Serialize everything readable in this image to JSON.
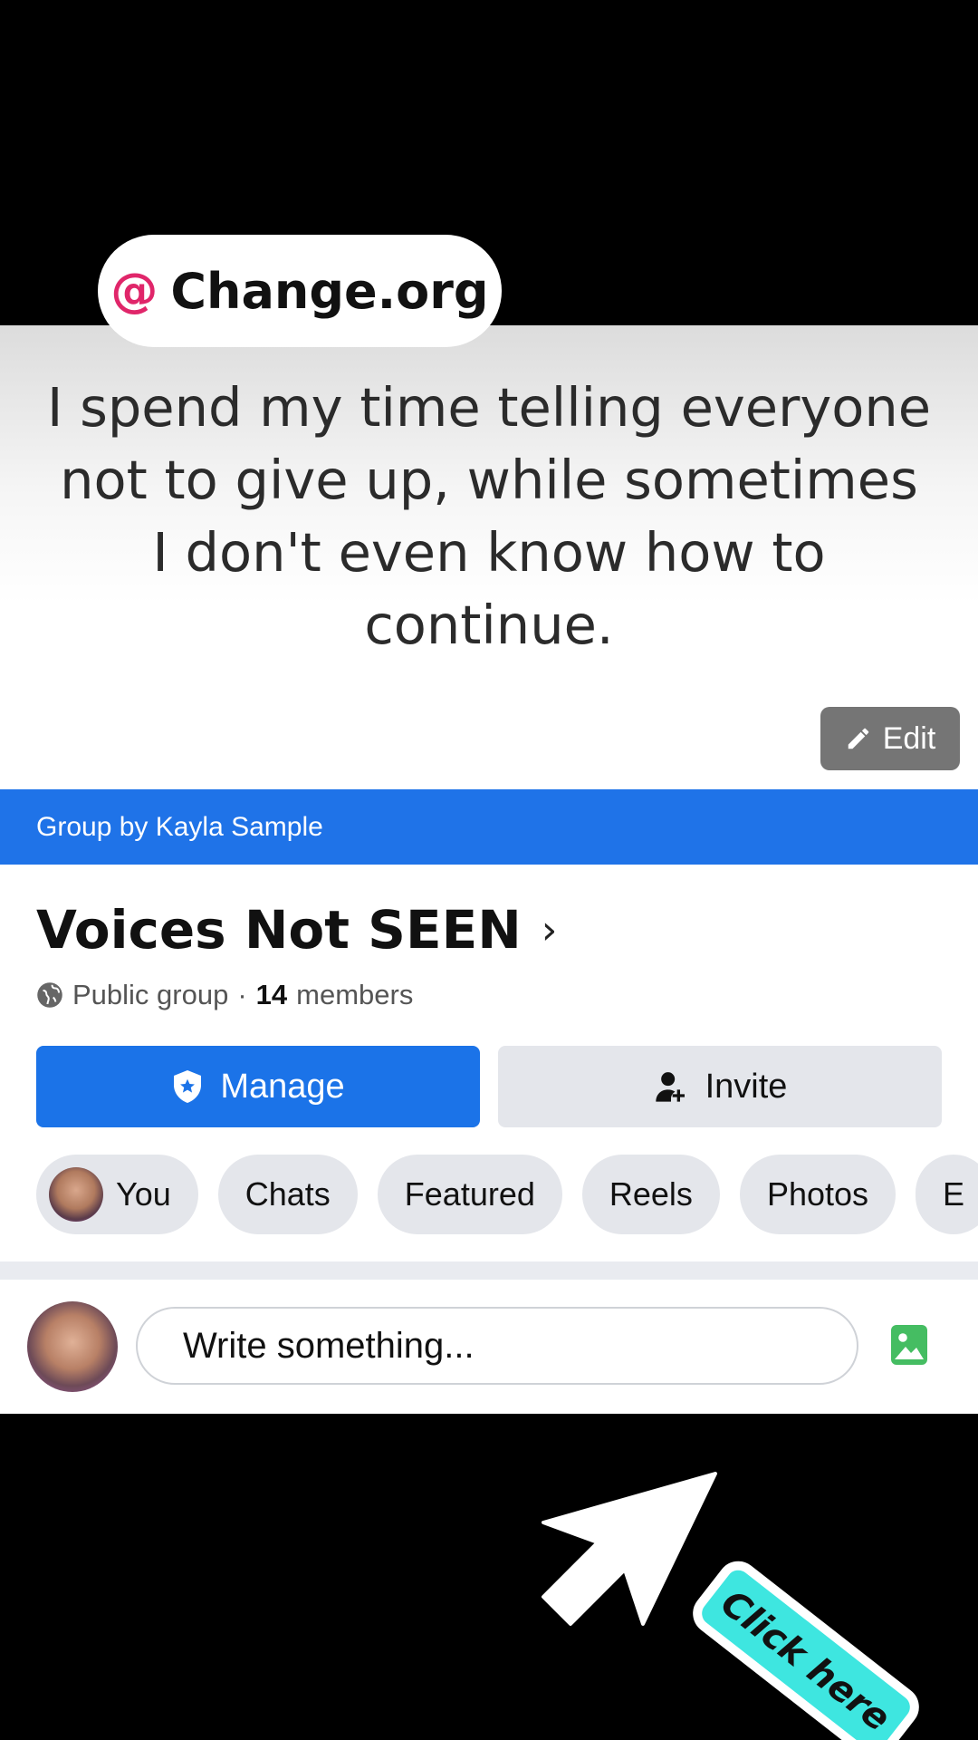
{
  "watermark": {
    "at_symbol": "@",
    "name": "Change.org"
  },
  "cover": {
    "quote_lines": [
      "I spend my time telling everyone",
      "not to give up, while sometimes",
      "I don't even know how to",
      "continue."
    ],
    "edit_label": "Edit"
  },
  "group_by": "Group by Kayla Sample",
  "group": {
    "name": "Voices Not SEEN",
    "chevron": "›",
    "privacy": "Public group",
    "separator": "·",
    "member_count": "14",
    "members_label": "members"
  },
  "actions": {
    "manage_label": "Manage",
    "invite_label": "Invite"
  },
  "tabs": [
    "You",
    "Chats",
    "Featured",
    "Reels",
    "Photos",
    "E"
  ],
  "composer": {
    "placeholder": "Write something..."
  },
  "overlay": {
    "cta_label": "Click here"
  },
  "colors": {
    "accent": "#1b73e8",
    "brand_at": "#e0266a",
    "cta": "#3ee6e0",
    "photo_icon": "#45bd62"
  },
  "icons": [
    "pencil-icon",
    "globe-icon",
    "shield-star-icon",
    "add-person-icon",
    "photo-icon",
    "arrow-cursor-icon"
  ]
}
